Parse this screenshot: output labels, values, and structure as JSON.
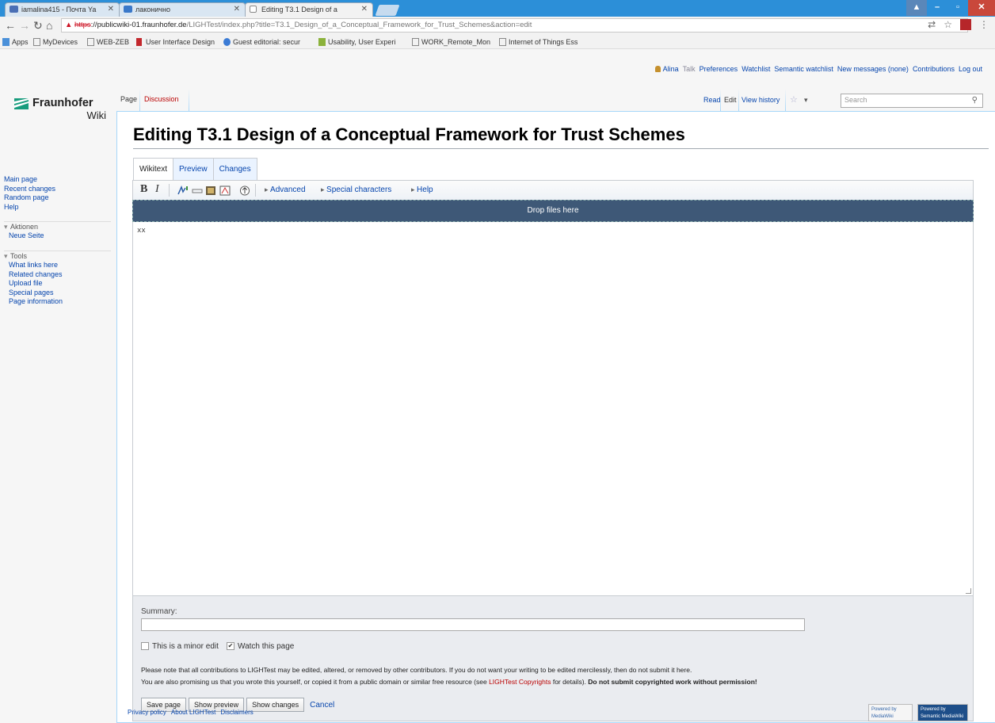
{
  "browser": {
    "tabs": [
      {
        "title": "iamalina415 - Почта Ya",
        "active": false
      },
      {
        "title": "лаконично",
        "active": false
      },
      {
        "title": "Editing T3.1 Design of a",
        "active": true
      }
    ],
    "url": {
      "scheme": "https",
      "host": "://publicwiki-01.fraunhofer.de",
      "path": "/LIGHTest/index.php?title=T3.1_Design_of_a_Conceptual_Framework_for_Trust_Schemes&action=edit"
    },
    "bookmarks": [
      "Apps",
      "MyDevices",
      "WEB-ZEB",
      "User Interface Design",
      "Guest editorial: secur",
      "Usability, User Experi",
      "WORK_Remote_Mon",
      "Internet of Things Ess"
    ],
    "colors": {
      "titlebar": "#2c8fd8"
    }
  },
  "personal": {
    "user": "Alina",
    "links": [
      "Talk",
      "Preferences",
      "Watchlist",
      "Semantic watchlist",
      "New messages (none)",
      "Contributions",
      "Log out"
    ]
  },
  "logo": {
    "name": "Fraunhofer",
    "sub": "Wiki"
  },
  "sidebar": {
    "main": [
      "Main page",
      "Recent changes",
      "Random page",
      "Help"
    ],
    "aktionen": {
      "heading": "Aktionen",
      "items": [
        "Neue Seite"
      ]
    },
    "tools": {
      "heading": "Tools",
      "items": [
        "What links here",
        "Related changes",
        "Upload file",
        "Special pages",
        "Page information"
      ]
    }
  },
  "pagetabs": {
    "left": [
      "Page",
      "Discussion"
    ],
    "right": [
      "Read",
      "Edit",
      "View history"
    ],
    "search_placeholder": "Search"
  },
  "heading": "Editing T3.1 Design of a Conceptual Framework for Trust Schemes",
  "editor": {
    "tabs": [
      "Wikitext",
      "Preview",
      "Changes"
    ],
    "toolbar": {
      "bold": "B",
      "italic": "I",
      "links": [
        "Advanced",
        "Special characters",
        "Help"
      ]
    },
    "dropzone": "Drop files here",
    "content": "xx"
  },
  "options": {
    "summary_label": "Summary:",
    "minor_edit": "This is a minor edit",
    "watch": "Watch this page",
    "notice1": "Please note that all contributions to LIGHTest may be edited, altered, or removed by other contributors. If you do not want your writing to be edited mercilessly, then do not submit it here.",
    "notice2_a": "You are also promising us that you wrote this yourself, or copied it from a public domain or similar free resource (see ",
    "notice2_link": "LIGHTest Copyrights",
    "notice2_b": " for details). ",
    "notice2_bold": "Do not submit copyrighted work without permission!",
    "buttons": [
      "Save page",
      "Show preview",
      "Show changes"
    ],
    "cancel": "Cancel"
  },
  "footer": {
    "links": [
      "Privacy policy",
      "About LIGHTest",
      "Disclaimers"
    ],
    "badges": [
      "Powered by MediaWiki",
      "Powered by Semantic MediaWiki"
    ]
  }
}
